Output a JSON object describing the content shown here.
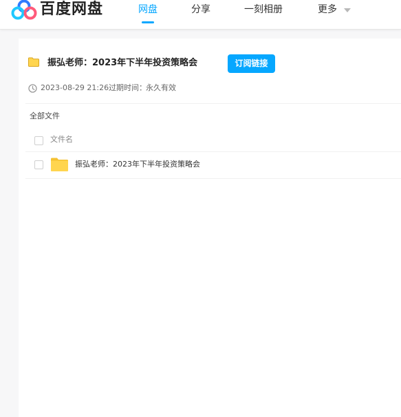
{
  "header": {
    "brand": "百度网盘",
    "nav": [
      {
        "label": "网盘",
        "active": true
      },
      {
        "label": "分享"
      },
      {
        "label": "一刻相册"
      },
      {
        "label": "更多"
      }
    ]
  },
  "share": {
    "title": "振弘老师：2023年下半年投资策略会",
    "subscribe_label": "订阅链接",
    "date": "2023-08-29 21:26",
    "expire_label": "过期时间：",
    "expire_value": "永久有效"
  },
  "files": {
    "breadcrumb": "全部文件",
    "column_name": "文件名",
    "rows": [
      {
        "name": "振弘老师：2023年下半年投资策略会",
        "type": "folder"
      }
    ]
  },
  "colors": {
    "accent": "#06a7ff",
    "folder": "#ffd54f",
    "folder_tab": "#f5c232"
  }
}
